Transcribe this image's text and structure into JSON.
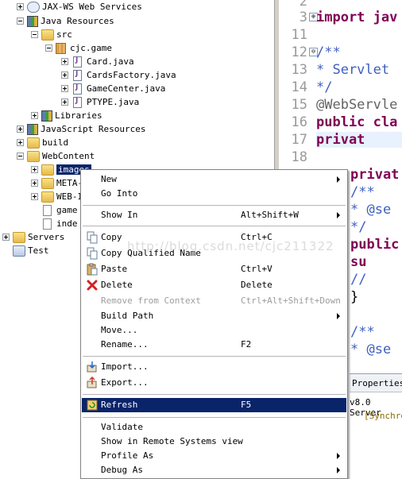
{
  "tree": {
    "items": [
      {
        "label": "JAX-WS Web Services"
      },
      {
        "label": "Java Resources"
      },
      {
        "label": "src"
      },
      {
        "label": "cjc.game"
      },
      {
        "label": "Card.java"
      },
      {
        "label": "CardsFactory.java"
      },
      {
        "label": "GameCenter.java"
      },
      {
        "label": "PTYPE.java"
      },
      {
        "label": "Libraries"
      },
      {
        "label": "JavaScript Resources"
      },
      {
        "label": "build"
      },
      {
        "label": "WebContent"
      },
      {
        "label": "images"
      },
      {
        "label": "META-"
      },
      {
        "label": "WEB-I"
      },
      {
        "label": "game"
      },
      {
        "label": "inde"
      },
      {
        "label": "Servers"
      },
      {
        "label": "Test"
      }
    ]
  },
  "editor": {
    "lines": [
      {
        "num": "2",
        "text": ""
      },
      {
        "num": "3",
        "text": "import jav",
        "fold": "⊕"
      },
      {
        "num": "11",
        "text": ""
      },
      {
        "num": "12",
        "text": "/**",
        "fold": "⊖"
      },
      {
        "num": "13",
        "text": " * Servlet"
      },
      {
        "num": "14",
        "text": " */"
      },
      {
        "num": "15",
        "text": "@WebServle"
      },
      {
        "num": "16",
        "text": "public cla"
      },
      {
        "num": "17",
        "text": "    privat"
      },
      {
        "num": "18",
        "text": ""
      }
    ],
    "right_lines": [
      "privat",
      "/**",
      " * @se",
      " */",
      "public",
      "    su",
      "    //",
      "}",
      "",
      "/**",
      " * @se"
    ]
  },
  "bottom_panel": {
    "tab_label": "Properties",
    "server_text": "v8.0 Server",
    "sync_text": "[Synchron"
  },
  "context_menu": {
    "items": [
      {
        "label": "New",
        "accel": "",
        "submenu": true
      },
      {
        "label": "Go Into",
        "accel": ""
      },
      {
        "label": "Show In",
        "accel": "Alt+Shift+W",
        "submenu": true
      },
      {
        "label": "Copy",
        "accel": "Ctrl+C",
        "icon": "copy-icon"
      },
      {
        "label": "Copy Qualified Name",
        "accel": "",
        "icon": "copy-qualified-name-icon"
      },
      {
        "label": "Paste",
        "accel": "Ctrl+V",
        "icon": "paste-icon"
      },
      {
        "label": "Delete",
        "accel": "Delete",
        "icon": "delete-icon"
      },
      {
        "label": "Remove from Context",
        "accel": "Ctrl+Alt+Shift+Down",
        "disabled": true
      },
      {
        "label": "Build Path",
        "accel": "",
        "submenu": true
      },
      {
        "label": "Move...",
        "accel": ""
      },
      {
        "label": "Rename...",
        "accel": "F2"
      },
      {
        "label": "Import...",
        "accel": "",
        "icon": "import-icon"
      },
      {
        "label": "Export...",
        "accel": "",
        "icon": "export-icon"
      },
      {
        "label": "Refresh",
        "accel": "F5",
        "highlighted": true,
        "icon": "refresh-icon"
      },
      {
        "label": "Validate",
        "accel": ""
      },
      {
        "label": "Show in Remote Systems view",
        "accel": ""
      },
      {
        "label": "Profile As",
        "accel": "",
        "submenu": true
      },
      {
        "label": "Debug As",
        "accel": "",
        "submenu": true
      }
    ]
  },
  "watermark": "http://blog.csdn.net/cjc211322"
}
